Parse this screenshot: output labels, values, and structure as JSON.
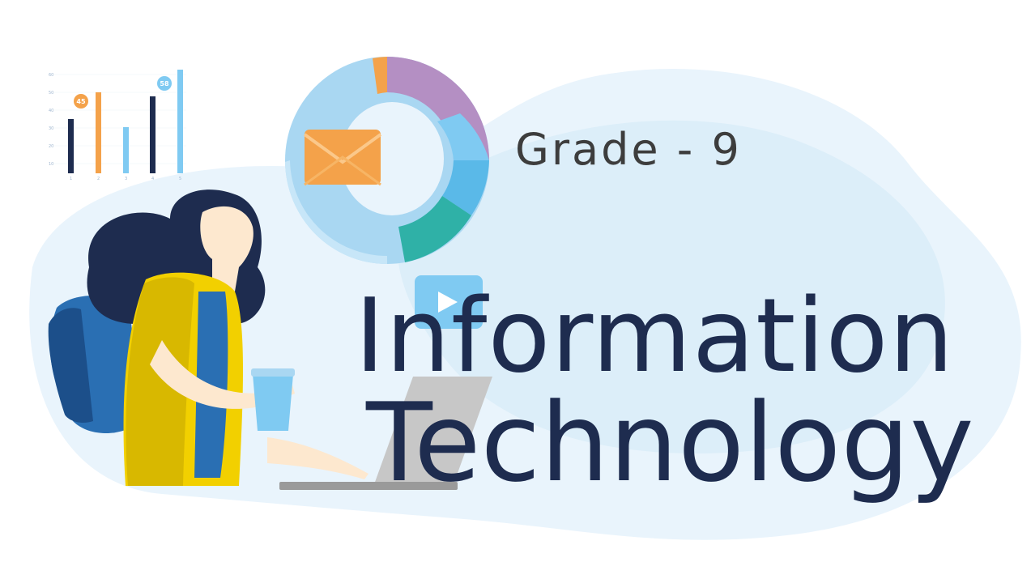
{
  "slide": {
    "grade": "Grade - 9",
    "title_line1": "Information",
    "title_line2": "Technology"
  },
  "mini_chart": {
    "ticks": [
      "60",
      "50",
      "40",
      "30",
      "20",
      "10"
    ],
    "x_labels": [
      "1",
      "2",
      "3",
      "4",
      "5"
    ],
    "bubble_labels": [
      "45",
      "58"
    ]
  },
  "colors": {
    "navy": "#1e2c4f",
    "blob": "#e6f2fb",
    "orange": "#f4a24a",
    "sky": "#7fcaf2",
    "yellow": "#f2d000",
    "teal": "#2fb1a7",
    "purple": "#b48fc3"
  }
}
